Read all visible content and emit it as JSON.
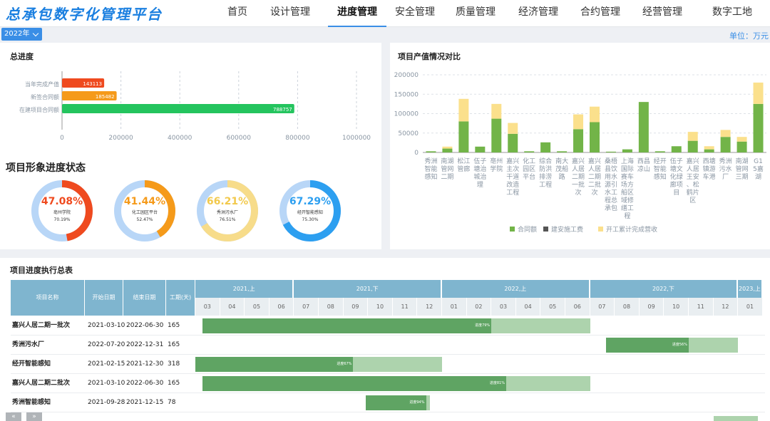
{
  "app": {
    "title": "总承包数字化管理平台"
  },
  "nav": {
    "items": [
      "首页",
      "设计管理",
      "进度管理",
      "安全管理",
      "质量管理",
      "经济管理",
      "合约管理",
      "经营管理",
      "数字工地"
    ],
    "active_index": 2
  },
  "filter": {
    "year": "2022年",
    "unit_label": "单位：万元"
  },
  "overall": {
    "title": "总进度",
    "bars": [
      {
        "label": "当年完成产值",
        "value": 143113,
        "color": "#ef4a1f"
      },
      {
        "label": "新签合同额",
        "value": 185482,
        "color": "#f59a1a"
      },
      {
        "label": "在建项目合同额",
        "value": 788757,
        "color": "#24c45e"
      }
    ],
    "ticks": [
      "0",
      "200000",
      "400000",
      "600000",
      "800000",
      "1000000"
    ]
  },
  "status": {
    "title": "项目形象进度状态",
    "donuts": [
      {
        "percent": "47.08%",
        "name": "亳州学院",
        "sub": "70.19%",
        "fraction": 0.4708,
        "color": "#ef4a1f",
        "track": "#b8d6f7",
        "text_color": "#ef4a1f"
      },
      {
        "percent": "41.44%",
        "name": "化工园区平台",
        "sub": "52.47%",
        "fraction": 0.4144,
        "color": "#f59a1a",
        "track": "#b8d6f7",
        "text_color": "#f59a1a"
      },
      {
        "percent": "66.21%",
        "name": "秀洲污水厂",
        "sub": "76.51%",
        "fraction": 0.6621,
        "color": "#f7dc8a",
        "track": "#b8d6f7",
        "text_color": "#f2c94c"
      },
      {
        "percent": "67.29%",
        "name": "经开智能感知",
        "sub": "75.30%",
        "fraction": 0.6729,
        "color": "#2d9ff0",
        "track": "#b8d6f7",
        "text_color": "#2d9ff0"
      }
    ]
  },
  "comparison": {
    "title": "项目产值情况对比",
    "legend": [
      "合同额",
      "建安施工费",
      "开工累计完成营收"
    ],
    "colors": [
      "#72b448",
      "#555555",
      "#fbe08c"
    ]
  },
  "chart_data": {
    "type": "bar",
    "categories": [
      "秀洲智能感知",
      "南湖管网二期",
      "松江管廊",
      "伍子塘治城治理",
      "亳州学院",
      "嘉兴主次干道改造工程",
      "化工园区平台",
      "综合防洪排涝工程",
      "南大茂船路",
      "嘉兴人居二期一批次",
      "嘉兴人居二期二批次",
      "桑梧县饮用水源引水工程总承包",
      "上海国际赛车场方船区域修缮工程",
      "西昌凉山",
      "经开智能感知",
      "伍子塘文化绿廊项目",
      "嘉兴人居王安、松鹤片区",
      "西塘镇游车港",
      "秀洲污水厂",
      "南湖管网三期",
      "G15嘉湖"
    ],
    "series": [
      {
        "name": "合同额",
        "values": [
          3000,
          10000,
          80000,
          15000,
          87000,
          48000,
          3000,
          26000,
          3000,
          60000,
          78000,
          2000,
          8000,
          130000,
          3000,
          16000,
          30000,
          8000,
          40000,
          28000,
          125000
        ]
      },
      {
        "name": "建安施工费",
        "values": [
          0,
          0,
          0,
          0,
          0,
          0,
          0,
          0,
          0,
          0,
          0,
          0,
          0,
          0,
          0,
          0,
          0,
          0,
          0,
          0,
          0
        ]
      },
      {
        "name": "开工累计完成营收",
        "values": [
          0,
          5000,
          58000,
          0,
          38000,
          28000,
          0,
          0,
          0,
          38000,
          40000,
          0,
          0,
          0,
          0,
          0,
          23000,
          8000,
          18000,
          12000,
          55000
        ]
      }
    ],
    "ylim": [
      0,
      200000
    ],
    "yticks": [
      "0",
      "50000",
      "100000",
      "150000",
      "200000"
    ],
    "stacked": true,
    "legend_position": "bottom"
  },
  "schedule": {
    "title": "项目进度执行总表",
    "columns": [
      "项目名称",
      "开始日期",
      "结束日期",
      "工期(天)"
    ],
    "periods": [
      {
        "label": "2021,上",
        "span": 4
      },
      {
        "label": "2021,下",
        "span": 6
      },
      {
        "label": "2022,上",
        "span": 6
      },
      {
        "label": "2022,下",
        "span": 6
      },
      {
        "label": "2023,上",
        "span": 1
      }
    ],
    "months": [
      "03",
      "04",
      "05",
      "06",
      "07",
      "08",
      "09",
      "10",
      "11",
      "12",
      "01",
      "02",
      "03",
      "04",
      "05",
      "06",
      "07",
      "08",
      "09",
      "10",
      "11",
      "12",
      "01"
    ],
    "rows": [
      {
        "name": "嘉兴人居二期一批次",
        "start": "2021-03-10",
        "end": "2022-06-30",
        "days": "165",
        "progress_label": "进度79%",
        "bar_start": 0.3,
        "bar_end": 16.0,
        "done_end": 12.0
      },
      {
        "name": "秀洲污水厂",
        "start": "2022-07-20",
        "end": "2022-12-31",
        "days": "165",
        "progress_label": "进度56%",
        "bar_start": 16.65,
        "bar_end": 22.0,
        "done_end": 20.0
      },
      {
        "name": "经开智能感知",
        "start": "2021-02-15",
        "end": "2021-12-30",
        "days": "318",
        "progress_label": "进度67%",
        "bar_start": 0.0,
        "bar_end": 10.0,
        "done_end": 6.4
      },
      {
        "name": "嘉兴人居二期二批次",
        "start": "2021-03-10",
        "end": "2022-06-30",
        "days": "165",
        "progress_label": "进度81%",
        "bar_start": 0.3,
        "bar_end": 16.0,
        "done_end": 12.6
      },
      {
        "name": "秀洲智能感知",
        "start": "2021-09-28",
        "end": "2021-12-15",
        "days": "78",
        "progress_label": "进度94%",
        "bar_start": 6.9,
        "bar_end": 9.5,
        "done_end": 9.35
      }
    ]
  },
  "pager": {
    "prev": "«",
    "next": "»"
  }
}
